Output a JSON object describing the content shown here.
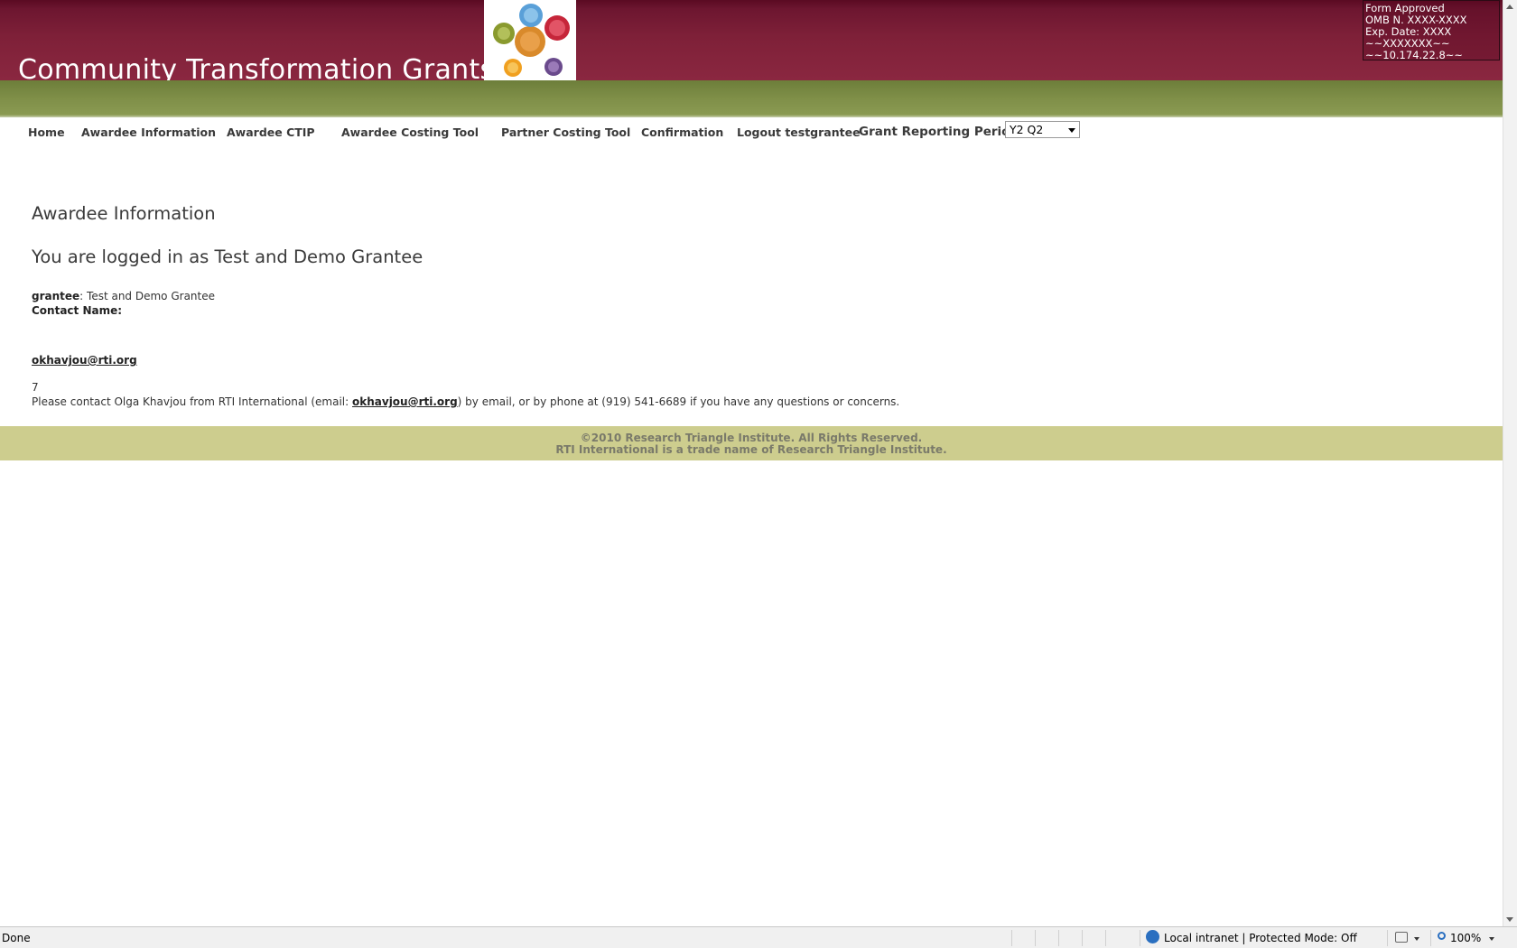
{
  "header": {
    "site_title": "Community Transformation Grants",
    "omb": [
      "Form Approved",
      "OMB N. XXXX-XXXX",
      "Exp. Date: XXXX",
      "~~XXXXXXX~~",
      "~~10.174.22.8~~"
    ],
    "colors": {
      "maroon": "#7e2038",
      "olive": "#7f8f48",
      "footer": "#cdcd8e"
    }
  },
  "nav": {
    "items": [
      "Home",
      "Awardee Information",
      "Awardee CTIP",
      "Awardee Costing Tool",
      "Partner Costing Tool",
      "Confirmation",
      "Logout testgrantee"
    ],
    "period_label": "Grant Reporting Period:",
    "period_value": "Y2 Q2"
  },
  "main": {
    "title": "Awardee Information",
    "logged_in": "You are logged in as Test and Demo Grantee",
    "grantee_label": "grantee",
    "grantee_value": ": Test and Demo Grantee",
    "contact_label": "Contact Name:",
    "email": "okhavjou@rti.org",
    "number": "7",
    "contact_prefix": "Please contact Olga Khavjou from RTI International (email: ",
    "contact_email": "okhavjou@rti.org",
    "contact_suffix": ") by email, or by phone at (919) 541-6689 if you have any questions or concerns."
  },
  "footer": {
    "line1": "©2010 Research Triangle Institute. All Rights Reserved.",
    "line2": "RTI International is a trade name of Research Triangle Institute."
  },
  "statusbar": {
    "status": "Done",
    "zone": "Local intranet | Protected Mode: Off",
    "zoom": "100%"
  }
}
